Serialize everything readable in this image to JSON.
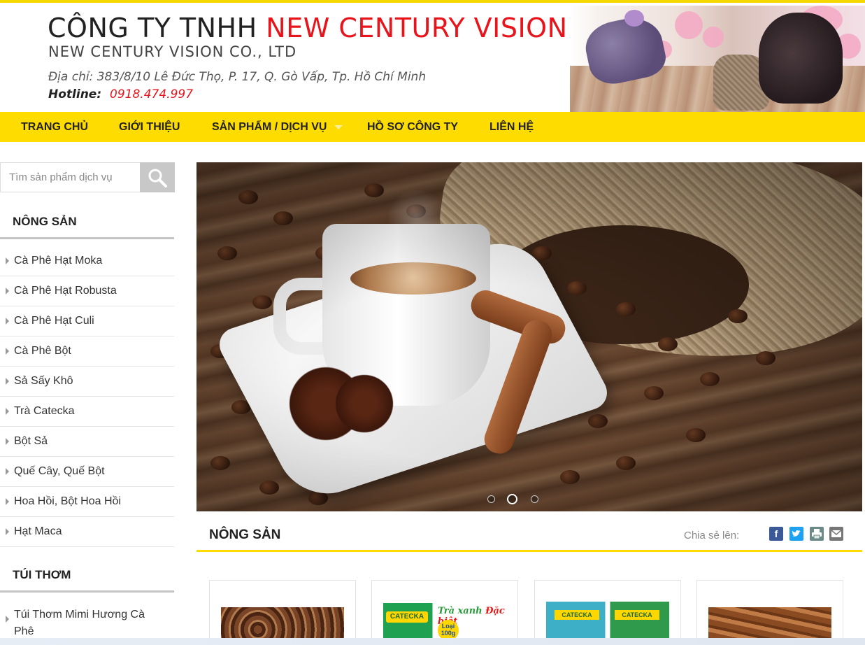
{
  "header": {
    "title_prefix": "CÔNG TY TNHH",
    "title_highlight": "NEW CENTURY VISION",
    "subtitle": "NEW CENTURY VISION CO., LTD",
    "address_label": "Địa chỉ:",
    "address": "383/8/10 Lê Đức Thọ, P. 17, Q. Gò Vấp, Tp. Hồ Chí Minh",
    "hotline_label": "Hotline:",
    "hotline": "0918.474.997"
  },
  "nav": {
    "items": [
      {
        "label": "TRANG CHỦ"
      },
      {
        "label": "GIỚI THIỆU"
      },
      {
        "label": "SẢN PHẨM / DỊCH VỤ"
      },
      {
        "label": "HỒ SƠ CÔNG TY"
      },
      {
        "label": "LIÊN HỆ"
      }
    ]
  },
  "search": {
    "placeholder": "Tìm sản phẩm dịch vụ",
    "icon": "search-icon"
  },
  "sidebar": {
    "groups": [
      {
        "heading": "NÔNG SẢN",
        "items": [
          "Cà Phê Hạt Moka",
          "Cà Phê Hạt Robusta",
          "Cà Phê Hạt Culi",
          "Cà Phê Bột",
          "Sả Sấy Khô",
          "Trà Catecka",
          "Bột Sả",
          "Quế Cây, Quế Bột",
          "Hoa Hồi, Bột Hoa Hồi",
          "Hạt Maca"
        ]
      },
      {
        "heading": "TÚI THƠM",
        "items": [
          "Túi Thơm Mimi Hương Cà Phê"
        ]
      }
    ]
  },
  "slider": {
    "slide_count": 3,
    "active_slide": 2
  },
  "section": {
    "title": "NÔNG SẢN",
    "share_label": "Chia sẻ lên:",
    "share_icons": [
      "facebook-icon",
      "twitter-icon",
      "print-icon",
      "email-icon"
    ]
  },
  "products": {
    "card2": {
      "brand": "CATECKA",
      "promo_a": "Trà xanh",
      "promo_b": "Đặc biệt",
      "badge": "Loại 100g"
    },
    "card3": {
      "brand_a": "CATECKA",
      "brand_b": "CATECKA"
    }
  },
  "colors": {
    "accent": "#ffdc00",
    "brand_red": "#e8141c"
  }
}
